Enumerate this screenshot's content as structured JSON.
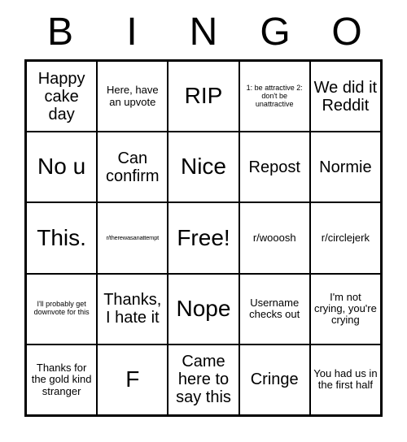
{
  "header": [
    "B",
    "I",
    "N",
    "G",
    "O"
  ],
  "grid": [
    [
      {
        "text": "Happy cake day",
        "size": "md"
      },
      {
        "text": "Here, have an upvote",
        "size": "sm"
      },
      {
        "text": "RIP",
        "size": "lg"
      },
      {
        "text": "1: be attractive 2: don't be unattractive",
        "size": "xs"
      },
      {
        "text": "We did it Reddit",
        "size": "md"
      }
    ],
    [
      {
        "text": "No u",
        "size": "lg"
      },
      {
        "text": "Can confirm",
        "size": "md"
      },
      {
        "text": "Nice",
        "size": "lg"
      },
      {
        "text": "Repost",
        "size": "md"
      },
      {
        "text": "Normie",
        "size": "md"
      }
    ],
    [
      {
        "text": "This.",
        "size": "lg"
      },
      {
        "text": "r/therewasanattempt",
        "size": "tiny"
      },
      {
        "text": "Free!",
        "size": "lg"
      },
      {
        "text": "r/wooosh",
        "size": "sm"
      },
      {
        "text": "r/circlejerk",
        "size": "sm"
      }
    ],
    [
      {
        "text": "I'll probably get downvote for this",
        "size": "xs"
      },
      {
        "text": "Thanks, I hate it",
        "size": "md"
      },
      {
        "text": "Nope",
        "size": "lg"
      },
      {
        "text": "Username checks out",
        "size": "sm"
      },
      {
        "text": "I'm not crying, you're crying",
        "size": "sm"
      }
    ],
    [
      {
        "text": "Thanks for the gold kind stranger",
        "size": "sm"
      },
      {
        "text": "F",
        "size": "lg"
      },
      {
        "text": "Came here to say this",
        "size": "md"
      },
      {
        "text": "Cringe",
        "size": "md"
      },
      {
        "text": "You had us in the first half",
        "size": "sm"
      }
    ]
  ]
}
